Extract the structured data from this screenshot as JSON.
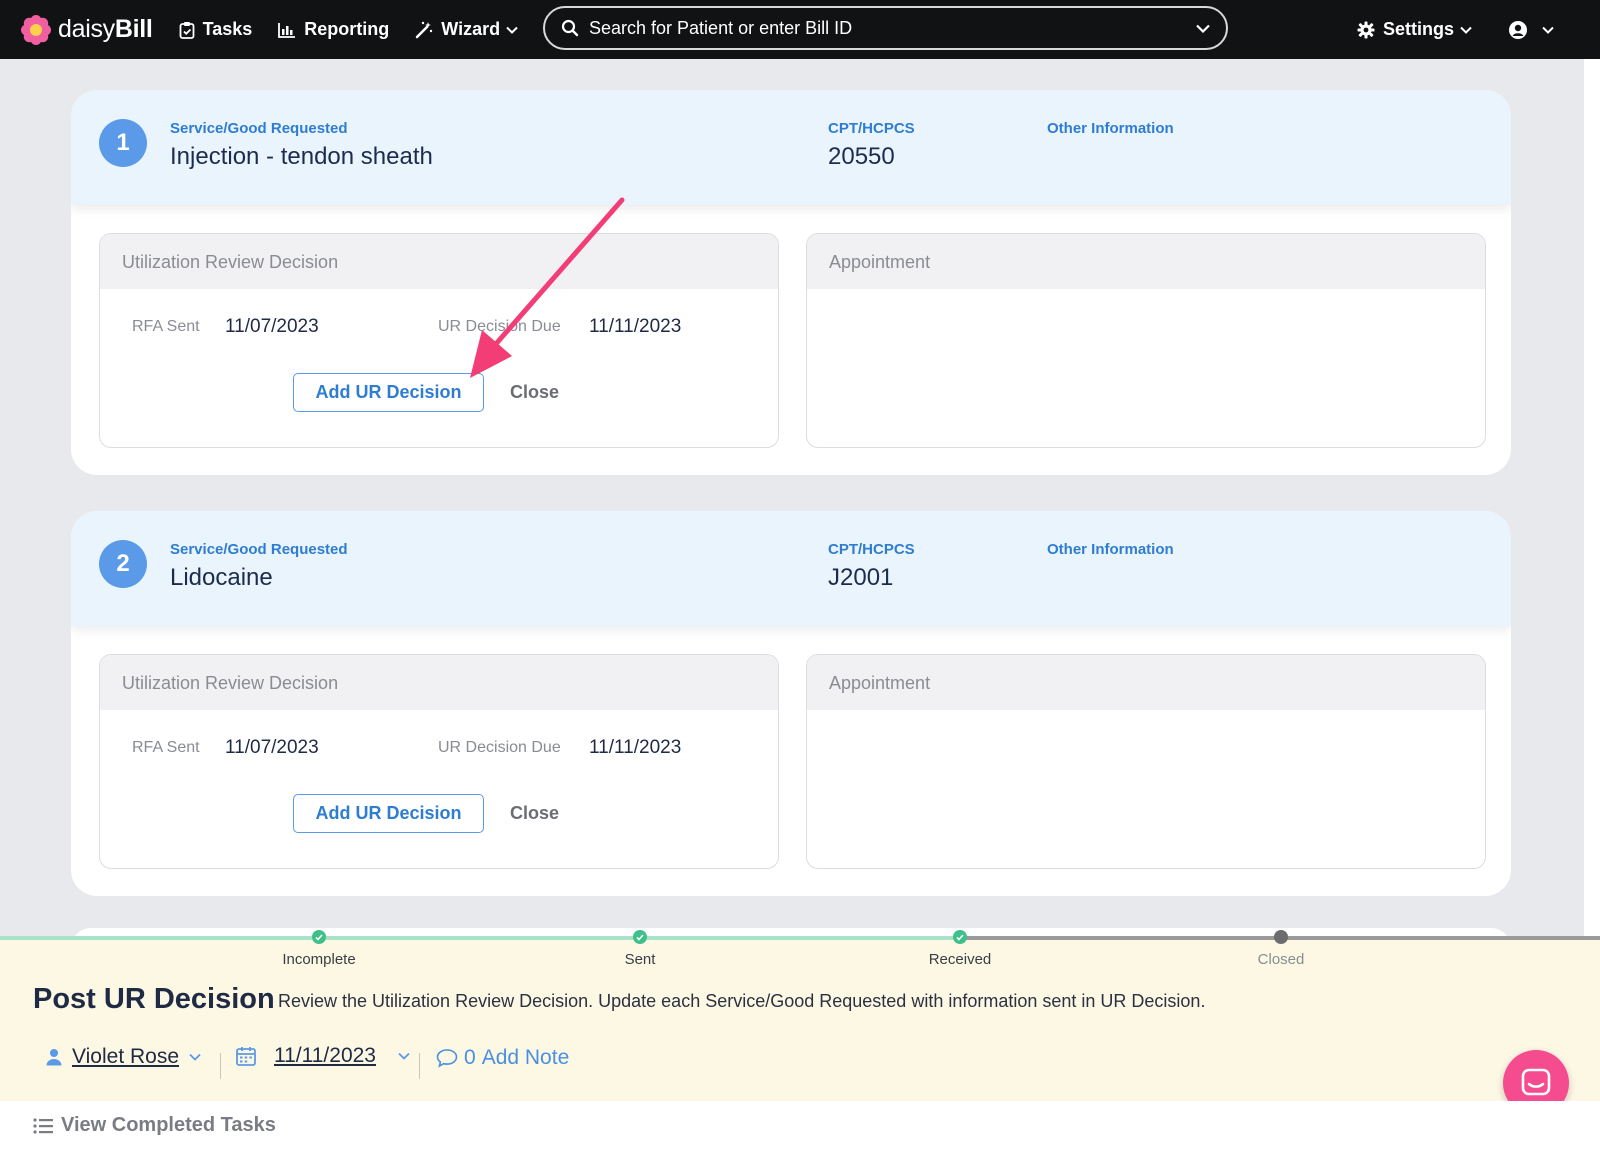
{
  "nav": {
    "brand_light": "daisy",
    "brand_bold": "Bill",
    "tasks": "Tasks",
    "reporting": "Reporting",
    "wizard": "Wizard",
    "search_placeholder": "Search for Patient or enter Bill ID",
    "settings": "Settings"
  },
  "requests": [
    {
      "number": "1",
      "service_label": "Service/Good Requested",
      "service": "Injection - tendon sheath",
      "cpt_label": "CPT/HCPCS",
      "cpt": "20550",
      "other_label": "Other Information",
      "ur_panel_title": "Utilization Review Decision",
      "rfa_sent_label": "RFA Sent",
      "rfa_sent": "11/07/2023",
      "ur_due_label": "UR Decision Due",
      "ur_due": "11/11/2023",
      "add_button": "Add UR Decision",
      "close_button": "Close",
      "appointment_title": "Appointment"
    },
    {
      "number": "2",
      "service_label": "Service/Good Requested",
      "service": "Lidocaine",
      "cpt_label": "CPT/HCPCS",
      "cpt": "J2001",
      "other_label": "Other Information",
      "ur_panel_title": "Utilization Review Decision",
      "rfa_sent_label": "RFA Sent",
      "rfa_sent": "11/07/2023",
      "ur_due_label": "UR Decision Due",
      "ur_due": "11/11/2023",
      "add_button": "Add UR Decision",
      "close_button": "Close",
      "appointment_title": "Appointment"
    }
  ],
  "task": {
    "steps": [
      {
        "label": "Incomplete",
        "done": true
      },
      {
        "label": "Sent",
        "done": true
      },
      {
        "label": "Received",
        "done": true
      },
      {
        "label": "Closed",
        "done": false
      }
    ],
    "title": "Post UR Decision",
    "description": "Review the Utilization Review Decision. Update each Service/Good Requested with information sent in UR Decision.",
    "assignee": "Violet Rose",
    "due_date": "11/11/2023",
    "note_count": "0",
    "note_label": "Add Note"
  },
  "footer": {
    "view_completed": "View Completed Tasks"
  },
  "colors": {
    "accent": "#2e7dd1",
    "badge": "#5a9ae8",
    "arrow": "#f23d77",
    "step_done": "#3fbf8a",
    "step_pending": "#7f7f7f",
    "chat_fab": "#f54b8f"
  }
}
